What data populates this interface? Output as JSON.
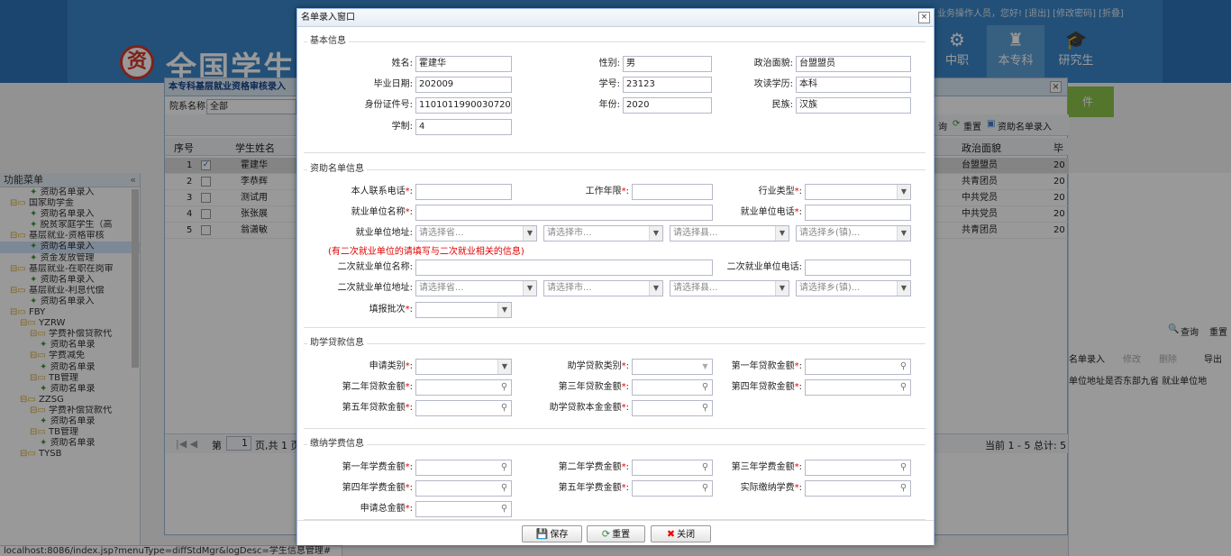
{
  "app": {
    "header_top_links": "您好! [退出] [修改密码] [折叠]",
    "header_user": "业务操作人员",
    "logo_text": "全国学生资",
    "nav": [
      {
        "label": "中职"
      },
      {
        "label": "本专科"
      },
      {
        "label": "研究生"
      }
    ],
    "green_button": "件",
    "left_menu": {
      "title": "功能菜单",
      "items": [
        {
          "label": "资助名单录入",
          "type": "leaf",
          "indent": 3
        },
        {
          "label": "国家助学金",
          "type": "folder",
          "indent": 1
        },
        {
          "label": "资助名单录入",
          "type": "leaf",
          "indent": 3
        },
        {
          "label": "脱贫家庭学生（高",
          "type": "leaf",
          "indent": 3
        },
        {
          "label": "基层就业-资格审核",
          "type": "folder",
          "indent": 1
        },
        {
          "label": "资助名单录入",
          "type": "leaf",
          "indent": 3,
          "selected": true
        },
        {
          "label": "资金发放管理",
          "type": "leaf",
          "indent": 3
        },
        {
          "label": "基层就业-在职在岗审",
          "type": "folder",
          "indent": 1
        },
        {
          "label": "资助名单录入",
          "type": "leaf",
          "indent": 3
        },
        {
          "label": "基层就业-利息代偿",
          "type": "folder",
          "indent": 1
        },
        {
          "label": "资助名单录入",
          "type": "leaf",
          "indent": 3
        },
        {
          "label": "FBY",
          "type": "folder",
          "indent": 1
        },
        {
          "label": "YZRW",
          "type": "folder",
          "indent": 2
        },
        {
          "label": "学费补偿贷款代",
          "type": "folder",
          "indent": 3
        },
        {
          "label": "资助名单录",
          "type": "leaf",
          "indent": 4
        },
        {
          "label": "学费减免",
          "type": "folder",
          "indent": 3
        },
        {
          "label": "资助名单录",
          "type": "leaf",
          "indent": 4
        },
        {
          "label": "TB管理",
          "type": "folder",
          "indent": 3
        },
        {
          "label": "资助名单录",
          "type": "leaf",
          "indent": 4
        },
        {
          "label": "ZZSG",
          "type": "folder",
          "indent": 2
        },
        {
          "label": "学费补偿贷款代",
          "type": "folder",
          "indent": 3
        },
        {
          "label": "资助名单录",
          "type": "leaf",
          "indent": 4
        },
        {
          "label": "TB管理",
          "type": "folder",
          "indent": 3
        },
        {
          "label": "资助名单录",
          "type": "leaf",
          "indent": 4
        },
        {
          "label": "TYSB",
          "type": "folder",
          "indent": 2
        }
      ]
    },
    "bg_panel": {
      "title": "本专科基层就业资格审核录入",
      "filter_label": "院系名称:",
      "filter_value": "全部",
      "toolbar": {
        "query": "询",
        "reset": "重置",
        "import": "资助名单录入"
      },
      "columns": {
        "seq": "序号",
        "name": "学生姓名",
        "politics": "政治面貌",
        "grad": "毕"
      },
      "rows": [
        {
          "seq": "1",
          "name": "霍建华",
          "politics": "台盟盟员",
          "grad": "20",
          "checked": true
        },
        {
          "seq": "2",
          "name": "李恭辉",
          "politics": "共青团员",
          "grad": "20",
          "checked": false
        },
        {
          "seq": "3",
          "name": "测试用",
          "politics": "中共党员",
          "grad": "20",
          "checked": false
        },
        {
          "seq": "4",
          "name": "张张展",
          "politics": "中共党员",
          "grad": "20",
          "checked": false
        },
        {
          "seq": "5",
          "name": "翁潇敏",
          "politics": "共青团员",
          "grad": "20",
          "checked": false
        }
      ],
      "pager_left": "第",
      "pager_page": "1",
      "pager_right": "页,共 1 页",
      "pager_summary": "当前 1 - 5 总计: 5"
    },
    "right_strip": {
      "query": "查询",
      "reset": "重置",
      "action1": "名单录入",
      "action2": "修改",
      "action3": "删除",
      "export": "导出",
      "col_text": "单位地址是否东部九省    就业单位地"
    },
    "status_url": "localhost:8086/index.jsp?menuType=diffStdMgr&logDesc=学生信息管理#"
  },
  "dialog": {
    "title": "名单录入窗口",
    "close": "×",
    "basic": {
      "legend": "基本信息",
      "name_label": "姓名:",
      "name_value": "霍建华",
      "gender_label": "性别:",
      "gender_value": "男",
      "politics_label": "政治面貌:",
      "politics_value": "台盟盟员",
      "graddate_label": "毕业日期:",
      "graddate_value": "202009",
      "studentno_label": "学号:",
      "studentno_value": "23123",
      "degree_label": "攻读学历:",
      "degree_value": "本科",
      "idcard_label": "身份证件号:",
      "idcard_value": "11010119900307205X",
      "year_label": "年份:",
      "year_value": "2020",
      "ethnic_label": "民族:",
      "ethnic_value": "汉族",
      "schooling_label": "学制:",
      "schooling_value": "4"
    },
    "aid": {
      "legend": "资助名单信息",
      "phone_label": "本人联系电话",
      "phone_value": "",
      "workyears_label": "工作年限",
      "workyears_value": "",
      "industry_label": "行业类型",
      "industry_value": "",
      "employer_label": "就业单位名称",
      "employer_value": "",
      "employer_phone_label": "就业单位电话",
      "employer_phone_value": "",
      "address_label": "就业单位地址:",
      "province_placeholder": "请选择省...",
      "city_placeholder": "请选择市...",
      "county_placeholder": "请选择县...",
      "town_placeholder": "请选择乡(镇)...",
      "note": "(有二次就业单位的请填写与二次就业相关的信息)",
      "second_employer_label": "二次就业单位名称:",
      "second_employer_value": "",
      "second_phone_label": "二次就业单位电话:",
      "second_phone_value": "",
      "second_address_label": "二次就业单位地址:",
      "batch_label": "填报批次",
      "batch_value": ""
    },
    "loan": {
      "legend": "助学贷款信息",
      "apply_type_label": "申请类别",
      "apply_type_value": "",
      "loan_type_label": "助学贷款类别",
      "loan_type_value": "",
      "y1_label": "第一年贷款金额",
      "y2_label": "第二年贷款金额",
      "y3_label": "第三年贷款金额",
      "y4_label": "第四年贷款金额",
      "y5_label": "第五年贷款金额",
      "principal_label": "助学贷款本金金额"
    },
    "tuition": {
      "legend": "缴纳学费信息",
      "y1_label": "第一年学费金额",
      "y2_label": "第二年学费金额",
      "y3_label": "第三年学费金额",
      "y4_label": "第四年学费金额",
      "y5_label": "第五年学费金额",
      "actual_label": "实际缴纳学费",
      "total_label": "申请总金额"
    },
    "buttons": {
      "save": "保存",
      "reset": "重置",
      "close": "关闭"
    },
    "required_mark": "*",
    "colon": ":"
  },
  "colors": {
    "banner": "#3b86c9",
    "required": "#e60000",
    "accent_green": "#8bc34a"
  },
  "icons": [
    "search-icon",
    "save-icon",
    "reset-icon",
    "close-icon",
    "dropdown-arrow-icon"
  ]
}
